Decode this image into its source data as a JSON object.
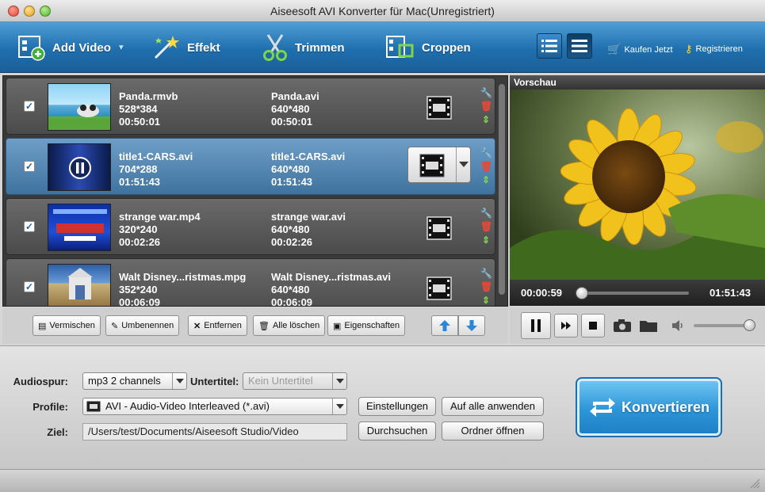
{
  "window": {
    "title": "Aiseesoft AVI Konverter für Mac(Unregistriert)"
  },
  "toolbar": {
    "add_video": "Add Video",
    "effekt": "Effekt",
    "trimmen": "Trimmen",
    "croppen": "Croppen",
    "kaufen": "Kaufen Jetzt",
    "registrieren": "Registrieren"
  },
  "files": [
    {
      "src_name": "Panda.rmvb",
      "src_res": "528*384",
      "src_dur": "00:50:01",
      "dst_name": "Panda.avi",
      "dst_res": "640*480",
      "dst_dur": "00:50:01",
      "checked": true,
      "selected": false
    },
    {
      "src_name": "title1-CARS.avi",
      "src_res": "704*288",
      "src_dur": "01:51:43",
      "dst_name": "title1-CARS.avi",
      "dst_res": "640*480",
      "dst_dur": "01:51:43",
      "checked": true,
      "selected": true
    },
    {
      "src_name": "strange war.mp4",
      "src_res": "320*240",
      "src_dur": "00:02:26",
      "dst_name": "strange war.avi",
      "dst_res": "640*480",
      "dst_dur": "00:02:26",
      "checked": true,
      "selected": false
    },
    {
      "src_name": "Walt Disney...ristmas.mpg",
      "src_res": "352*240",
      "src_dur": "00:06:09",
      "dst_name": "Walt Disney...ristmas.avi",
      "dst_res": "640*480",
      "dst_dur": "00:06:09",
      "checked": true,
      "selected": false
    }
  ],
  "list_actions": {
    "vermischen": "Vermischen",
    "umbenennen": "Umbenennen",
    "entfernen": "Entfernen",
    "alle_loeschen": "Alle löschen",
    "eigenschaften": "Eigenschaften"
  },
  "preview": {
    "header": "Vorschau",
    "current_time": "00:00:59",
    "total_time": "01:51:43",
    "progress": 0.01,
    "volume": 1.0
  },
  "settings": {
    "audiospur_label": "Audiospur:",
    "audiospur_value": "mp3 2 channels",
    "untertitel_label": "Untertitel:",
    "untertitel_value": "Kein Untertitel",
    "profile_label": "Profile:",
    "profile_value": "AVI - Audio-Video Interleaved (*.avi)",
    "ziel_label": "Ziel:",
    "ziel_value": "/Users/test/Documents/Aiseesoft Studio/Video",
    "einstellungen": "Einstellungen",
    "auf_alle": "Auf alle anwenden",
    "durchsuchen": "Durchsuchen",
    "ordner_oeffnen": "Ordner öffnen",
    "konvertieren": "Konvertieren"
  },
  "colors": {
    "accent": "#2c95d8",
    "selected_row": "#4f83ae"
  }
}
